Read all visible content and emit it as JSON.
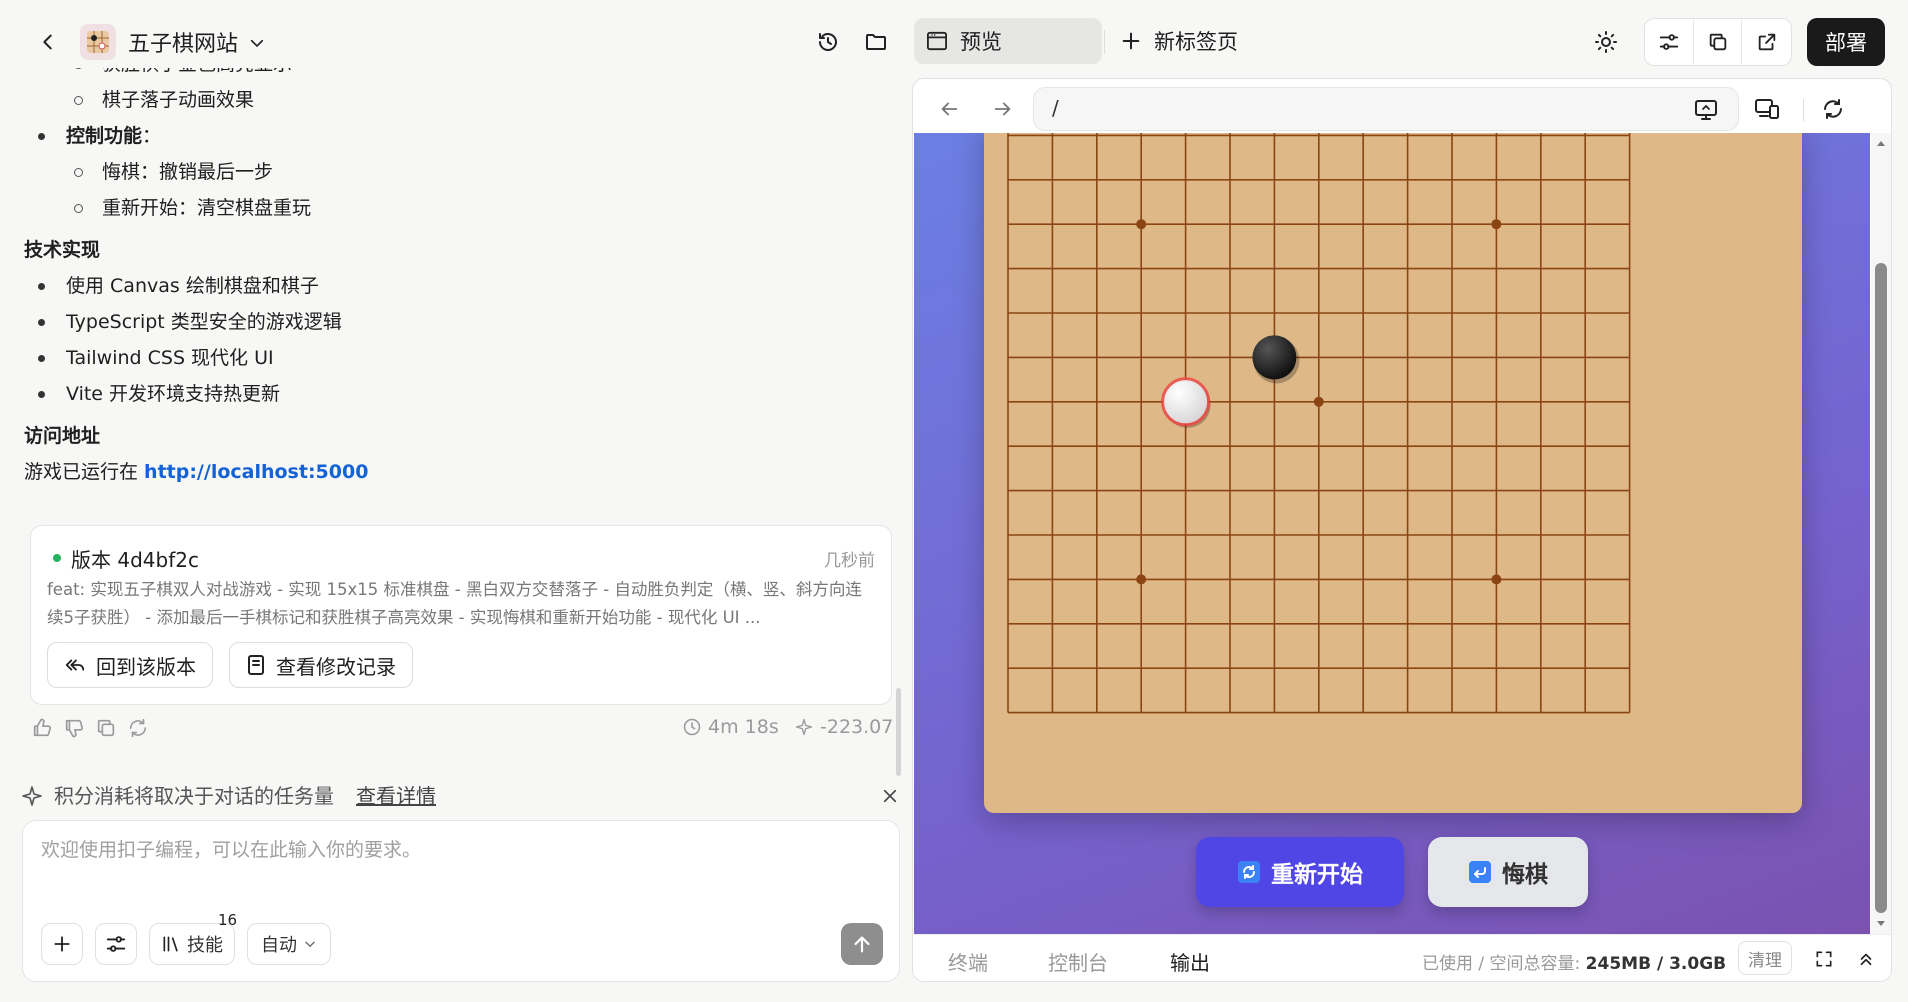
{
  "header": {
    "app_title": "五子棋网站",
    "tabs": {
      "preview": "预览",
      "new_tab": "新标签页"
    },
    "deploy": "部署"
  },
  "chat": {
    "lines": [
      {
        "kind": "sub",
        "text": "获胜棋子金色高亮显示"
      },
      {
        "kind": "sub",
        "text": "棋子落子动画效果"
      },
      {
        "kind": "bullet_bold",
        "bold": "控制功能",
        "text": "："
      },
      {
        "kind": "sub",
        "text": "悔棋：撤销最后一步"
      },
      {
        "kind": "sub",
        "text": "重新开始：清空棋盘重玩"
      },
      {
        "kind": "heading",
        "text": "技术实现"
      },
      {
        "kind": "bullet",
        "text": "使用 Canvas 绘制棋盘和棋子"
      },
      {
        "kind": "bullet",
        "text": "TypeScript 类型安全的游戏逻辑"
      },
      {
        "kind": "bullet",
        "text": "Tailwind CSS 现代化 UI"
      },
      {
        "kind": "bullet",
        "text": "Vite 开发环境支持热更新"
      },
      {
        "kind": "heading",
        "text": "访问地址"
      }
    ],
    "access_prefix": "游戏已运行在 ",
    "access_link": "http://localhost:5000"
  },
  "version": {
    "title": "版本 4d4bf2c",
    "time": "几秒前",
    "desc": "feat: 实现五子棋双人对战游戏 - 实现 15x15 标准棋盘 - 黑白双方交替落子 - 自动胜负判定（横、竖、斜方向连续5子获胜） - 添加最后一手棋标记和获胜棋子高亮效果 - 实现悔棋和重新开始功能 - 现代化 UI ...",
    "rollback": "回到该版本",
    "view_changes": "查看修改记录"
  },
  "meta": {
    "duration": "4m 18s",
    "credits": "-223.07"
  },
  "notice": {
    "text": "积分消耗将取决于对话的任务量",
    "link": "查看详情"
  },
  "composer": {
    "placeholder": "欢迎使用扣子编程，可以在此输入你的要求。",
    "skills_label": "技能",
    "skills_count": "16",
    "mode": "自动"
  },
  "browser": {
    "url": "/",
    "game": {
      "restart": "重新开始",
      "undo": "悔棋",
      "board_size": 15
    },
    "bottom_tabs": [
      "终端",
      "控制台",
      "输出"
    ],
    "storage_label": "已使用 / 空间总容量: ",
    "storage_value": "245MB / 3.0GB",
    "clear": "清理"
  },
  "colors": {
    "accent": "#4f46e5",
    "link": "#1463d6",
    "board": "#deb887",
    "grid": "#8b4513"
  }
}
